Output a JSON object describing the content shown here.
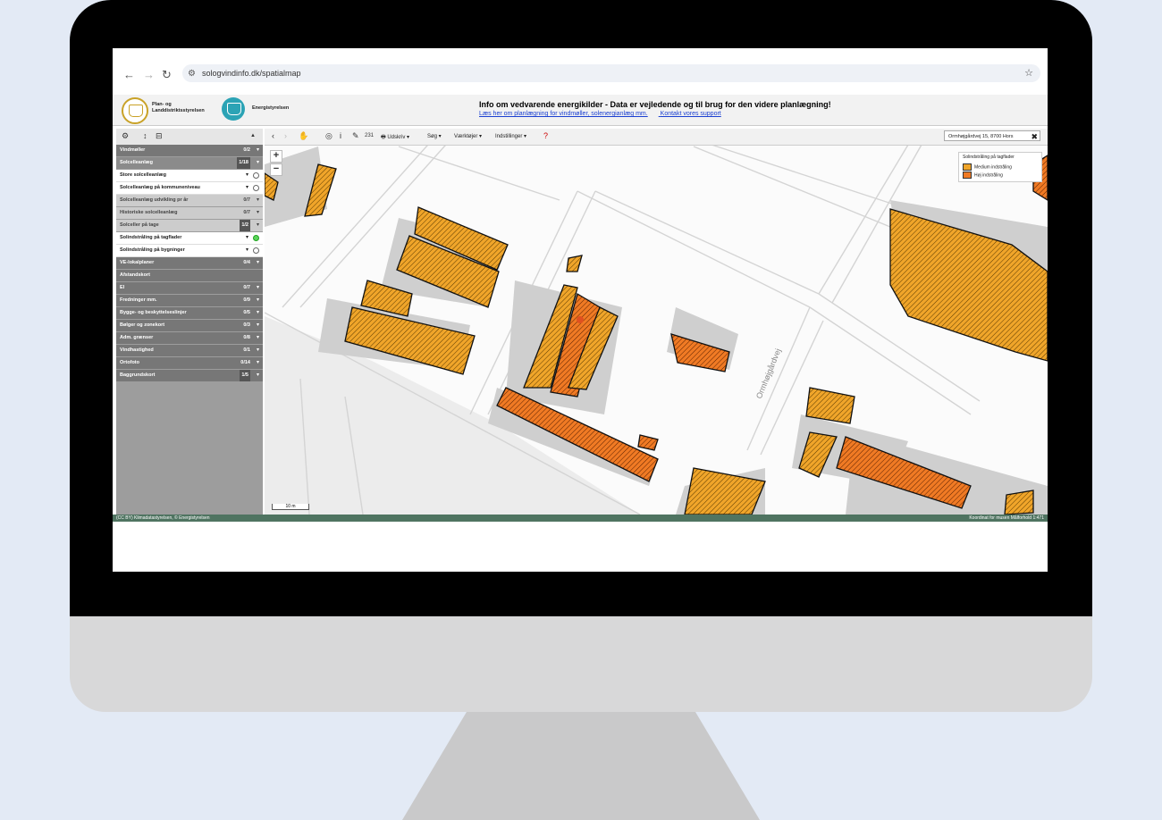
{
  "browser": {
    "url": "sologvindinfo.dk/spatialmap"
  },
  "header": {
    "org1_line1": "Plan- og",
    "org1_line2": "Landdistriktsstyrelsen",
    "org2": "Energistyrelsen",
    "title": "Info om vedvarende energikilder - Data er vejledende og til brug for den videre planlægning!",
    "link1": "Læs her om planlægning for vindmøller, solenergianlæg mm.",
    "link2": "Kontakt vores support"
  },
  "sidebar": {
    "layers": [
      {
        "label": "Vindmøller",
        "count": "0/2",
        "style": "main"
      },
      {
        "label": "Solcelleanlæg",
        "count": "1/18",
        "style": "open"
      },
      {
        "label": "Store solcelleanlæg",
        "count": "",
        "style": "white"
      },
      {
        "label": "Solcelleanlæg på kommuneniveau",
        "count": "",
        "style": "white"
      },
      {
        "label": "Solcelleanlæg udvikling pr år",
        "count": "0/7",
        "style": "sub"
      },
      {
        "label": "Historiske solcelleanlæg",
        "count": "0/7",
        "style": "sub"
      },
      {
        "label": "Solceller på tage",
        "count": "1/2",
        "style": "sub"
      },
      {
        "label": "Solindstråling på tagflader",
        "count": "",
        "style": "white",
        "active": true
      },
      {
        "label": "Solindstråling på bygninger",
        "count": "",
        "style": "white"
      },
      {
        "label": "VE-lokalplaner",
        "count": "0/4",
        "style": "main"
      },
      {
        "label": "Afstandskort",
        "count": "",
        "style": "main"
      },
      {
        "label": "El",
        "count": "0/7",
        "style": "main"
      },
      {
        "label": "Fredninger mm.",
        "count": "0/9",
        "style": "main"
      },
      {
        "label": "Bygge- og beskyttelseslinjer",
        "count": "0/5",
        "style": "main"
      },
      {
        "label": "Bølger og zonekort",
        "count": "0/3",
        "style": "main"
      },
      {
        "label": "Adm. grænser",
        "count": "0/8",
        "style": "main"
      },
      {
        "label": "Vindhastighed",
        "count": "0/1",
        "style": "main"
      },
      {
        "label": "Ortofoto",
        "count": "0/14",
        "style": "main"
      },
      {
        "label": "Baggrundskort",
        "count": "1/5",
        "style": "main"
      }
    ]
  },
  "map": {
    "toolbar": {
      "print": "Udskriv",
      "search": "Søg",
      "tools": "Værktøjer",
      "settings": "Indstillinger",
      "search_value": "Ormhøjgårdvej 15, 8700 Hors"
    },
    "legend": {
      "title": "Solindstråling på tagflader",
      "items": [
        {
          "label": "Medium indstråling",
          "color": "#f0a52a"
        },
        {
          "label": "Høj indstråling",
          "color": "#f07a24"
        }
      ]
    },
    "road_label": "Ormhøjgårdvej",
    "scale_label": "10 m"
  },
  "footer": {
    "left": "(CC BY) Klimadatastyrelsen, © Energistyrelsen",
    "right": "Koordinat for musen   Målforhold 1:471"
  }
}
